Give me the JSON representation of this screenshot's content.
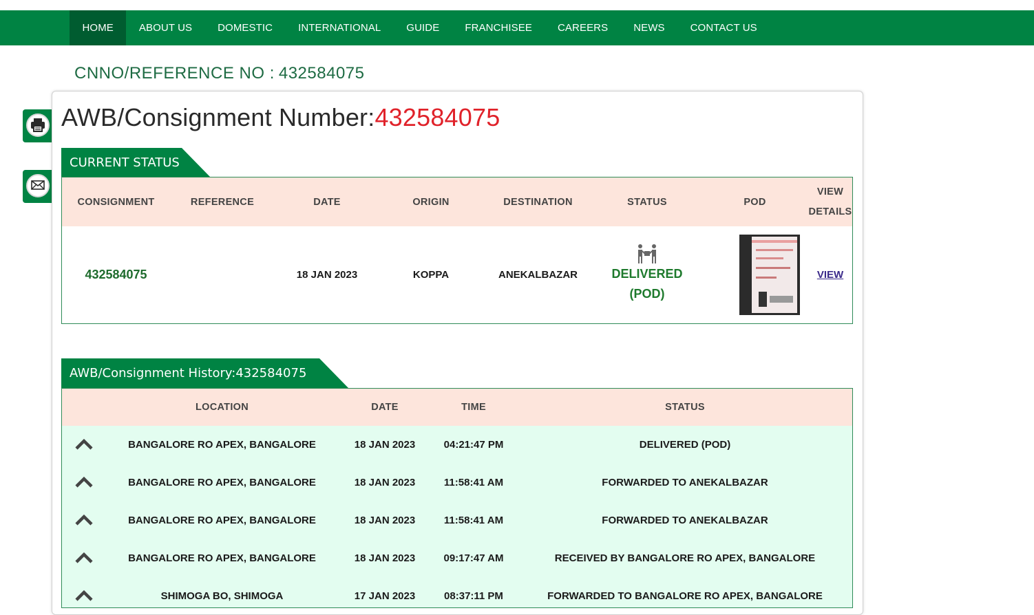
{
  "nav": {
    "items": [
      "HOME",
      "ABOUT US",
      "DOMESTIC",
      "INTERNATIONAL",
      "GUIDE",
      "FRANCHISEE",
      "CAREERS",
      "NEWS",
      "CONTACT US"
    ],
    "active": "HOME"
  },
  "reference": {
    "label": "CNNO/REFERENCE NO :",
    "value": "432584075"
  },
  "side_buttons": [
    "printer-icon",
    "mail-icon"
  ],
  "awb": {
    "label": "AWB/Consignment Number:",
    "number": "432584075"
  },
  "current_status": {
    "tab_label": "CURRENT STATUS",
    "headers": {
      "consignment": "CONSIGNMENT",
      "reference": "REFERENCE",
      "date": "DATE",
      "origin": "ORIGIN",
      "destination": "DESTINATION",
      "status": "STATUS",
      "pod": "POD",
      "view_line1": "VIEW",
      "view_line2": "DETAILS"
    },
    "row": {
      "consignment": "432584075",
      "reference": "",
      "date": "18 JAN 2023",
      "origin": "KOPPA",
      "destination": "ANEKALBAZAR",
      "status_line1": "DELIVERED",
      "status_line2": "(POD)",
      "view": "VIEW"
    }
  },
  "history": {
    "tab_label": "AWB/Consignment History:432584075",
    "headers": {
      "location": "LOCATION",
      "date": "DATE",
      "time": "TIME",
      "status": "STATUS"
    },
    "rows": [
      {
        "location": "BANGALORE RO APEX, BANGALORE",
        "date": "18 JAN 2023",
        "time": "04:21:47 PM",
        "status": "DELIVERED (POD)"
      },
      {
        "location": "BANGALORE RO APEX, BANGALORE",
        "date": "18 JAN 2023",
        "time": "11:58:41 AM",
        "status": "FORWARDED TO ANEKALBAZAR"
      },
      {
        "location": "BANGALORE RO APEX, BANGALORE",
        "date": "18 JAN 2023",
        "time": "11:58:41 AM",
        "status": "FORWARDED TO ANEKALBAZAR"
      },
      {
        "location": "BANGALORE RO APEX, BANGALORE",
        "date": "18 JAN 2023",
        "time": "09:17:47 AM",
        "status": "RECEIVED BY BANGALORE RO APEX, BANGALORE"
      },
      {
        "location": "SHIMOGA BO, SHIMOGA",
        "date": "17 JAN 2023",
        "time": "08:37:11 PM",
        "status": "FORWARDED TO BANGALORE RO APEX, BANGALORE"
      }
    ]
  },
  "colors": {
    "brand_green": "#008343",
    "accent_red": "#e0222a",
    "header_peach": "#fde5dc",
    "row_mint": "#e3fdf0"
  }
}
